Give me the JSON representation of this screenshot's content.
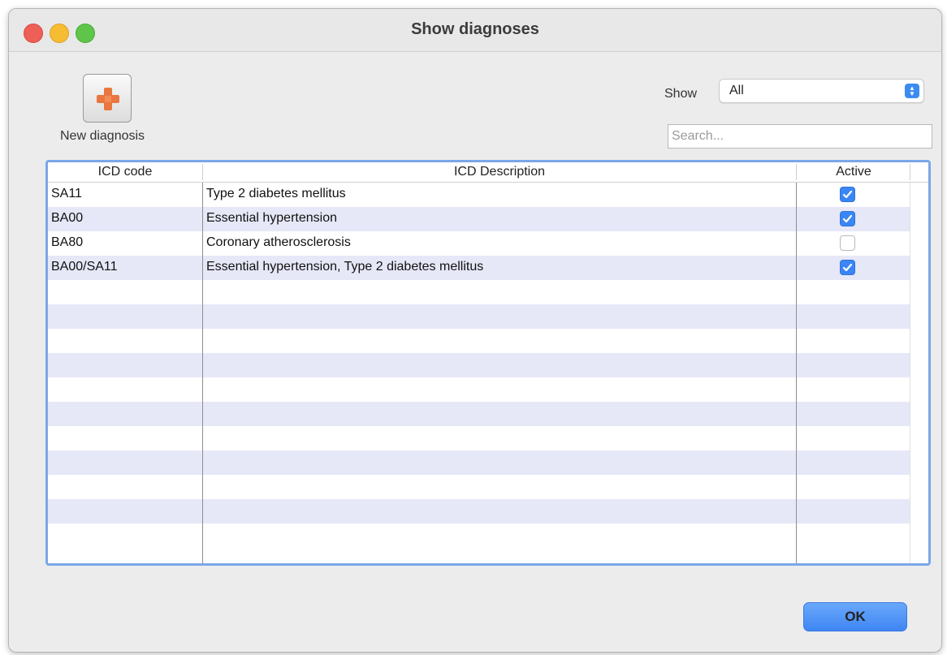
{
  "window": {
    "title": "Show diagnoses"
  },
  "toolbar": {
    "new_label": "New diagnosis",
    "new_icon": "add-plus-icon"
  },
  "filter": {
    "show_label": "Show",
    "selected": "All",
    "search_placeholder": "Search..."
  },
  "table": {
    "headers": {
      "code": "ICD code",
      "description": "ICD Description",
      "active": "Active"
    },
    "rows": [
      {
        "code": "SA11",
        "description": "Type 2 diabetes mellitus",
        "active": true
      },
      {
        "code": "BA00",
        "description": "Essential hypertension",
        "active": true
      },
      {
        "code": "BA80",
        "description": "Coronary atherosclerosis",
        "active": false
      },
      {
        "code": "BA00/SA11",
        "description": "Essential hypertension, Type 2 diabetes mellitus",
        "active": true
      }
    ],
    "blank_row_count": 11,
    "stripe_color": "#e6e8f8",
    "accent_color": "#3b86f5"
  },
  "footer": {
    "ok_label": "OK"
  }
}
